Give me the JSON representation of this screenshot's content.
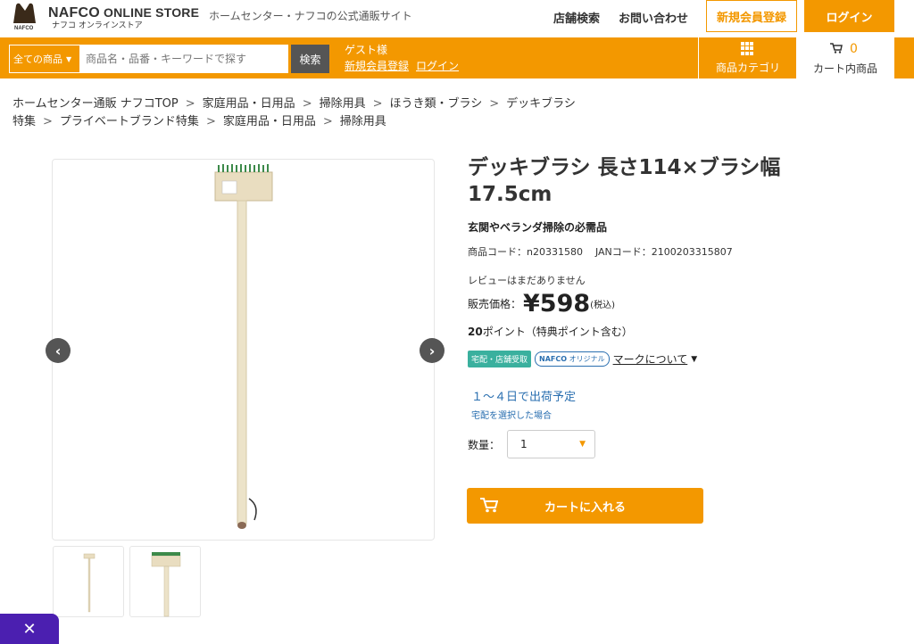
{
  "header": {
    "logo_main": "NAFCO",
    "logo_sub_en": "ONLINE STORE",
    "logo_sub_jp": "ナフコ オンラインストア",
    "logo_mark_text": "NAFCO",
    "tagline": "ホームセンター・ナフコの公式通販サイト",
    "store_search": "店舗検索",
    "contact": "お問い合わせ",
    "register_button": "新規会員登録",
    "login_button": "ログイン"
  },
  "search_bar": {
    "category_select": "全ての商品",
    "placeholder": "商品名・品番・キーワードで探す",
    "value": "",
    "search_button": "検索",
    "guest_label": "ゲスト様",
    "guest_register": "新規会員登録",
    "guest_login": "ログイン",
    "category_nav": "商品カテゴリ",
    "cart_count": "0",
    "cart_label": "カート内商品"
  },
  "breadcrumbs": [
    [
      "ホームセンター通販 ナフコTOP",
      "家庭用品・日用品",
      "掃除用具",
      "ほうき類・ブラシ",
      "デッキブラシ"
    ],
    [
      "特集",
      "プライベートブランド特集",
      "家庭用品・日用品",
      "掃除用具"
    ]
  ],
  "breadcrumb_separator": ">",
  "product": {
    "title": "デッキブラシ 長さ114×ブラシ幅17.5cm",
    "subtitle": "玄関やベランダ掃除の必需品",
    "product_code": "商品コード：n20331580",
    "jan_code": "JANコード：2100203315807",
    "review_text": "レビューはまだありません",
    "price_label": "販売価格：",
    "price": "¥598",
    "tax_note": "(税込)",
    "points_value": "20",
    "points_label": "ポイント（特典ポイント含む）",
    "badge_delivery": "宅配・店舗受取",
    "badge_original": "オリジナル",
    "badge_original_brand": "NAFCO",
    "mark_link": "マークについて",
    "shipping": "１～４日で出荷予定",
    "shipping_note": "宅配を選択した場合",
    "qty_label": "数量：",
    "qty_value": "1",
    "add_to_cart": "カートに入れる"
  },
  "gallery": {
    "prev_arrow": "‹",
    "next_arrow": "›"
  },
  "close_tab_label": "✕",
  "colors": {
    "accent": "#f39800",
    "badge_green": "#3ab09e",
    "link_blue": "#2a6fb0",
    "close_tab": "#4b1fb0"
  }
}
